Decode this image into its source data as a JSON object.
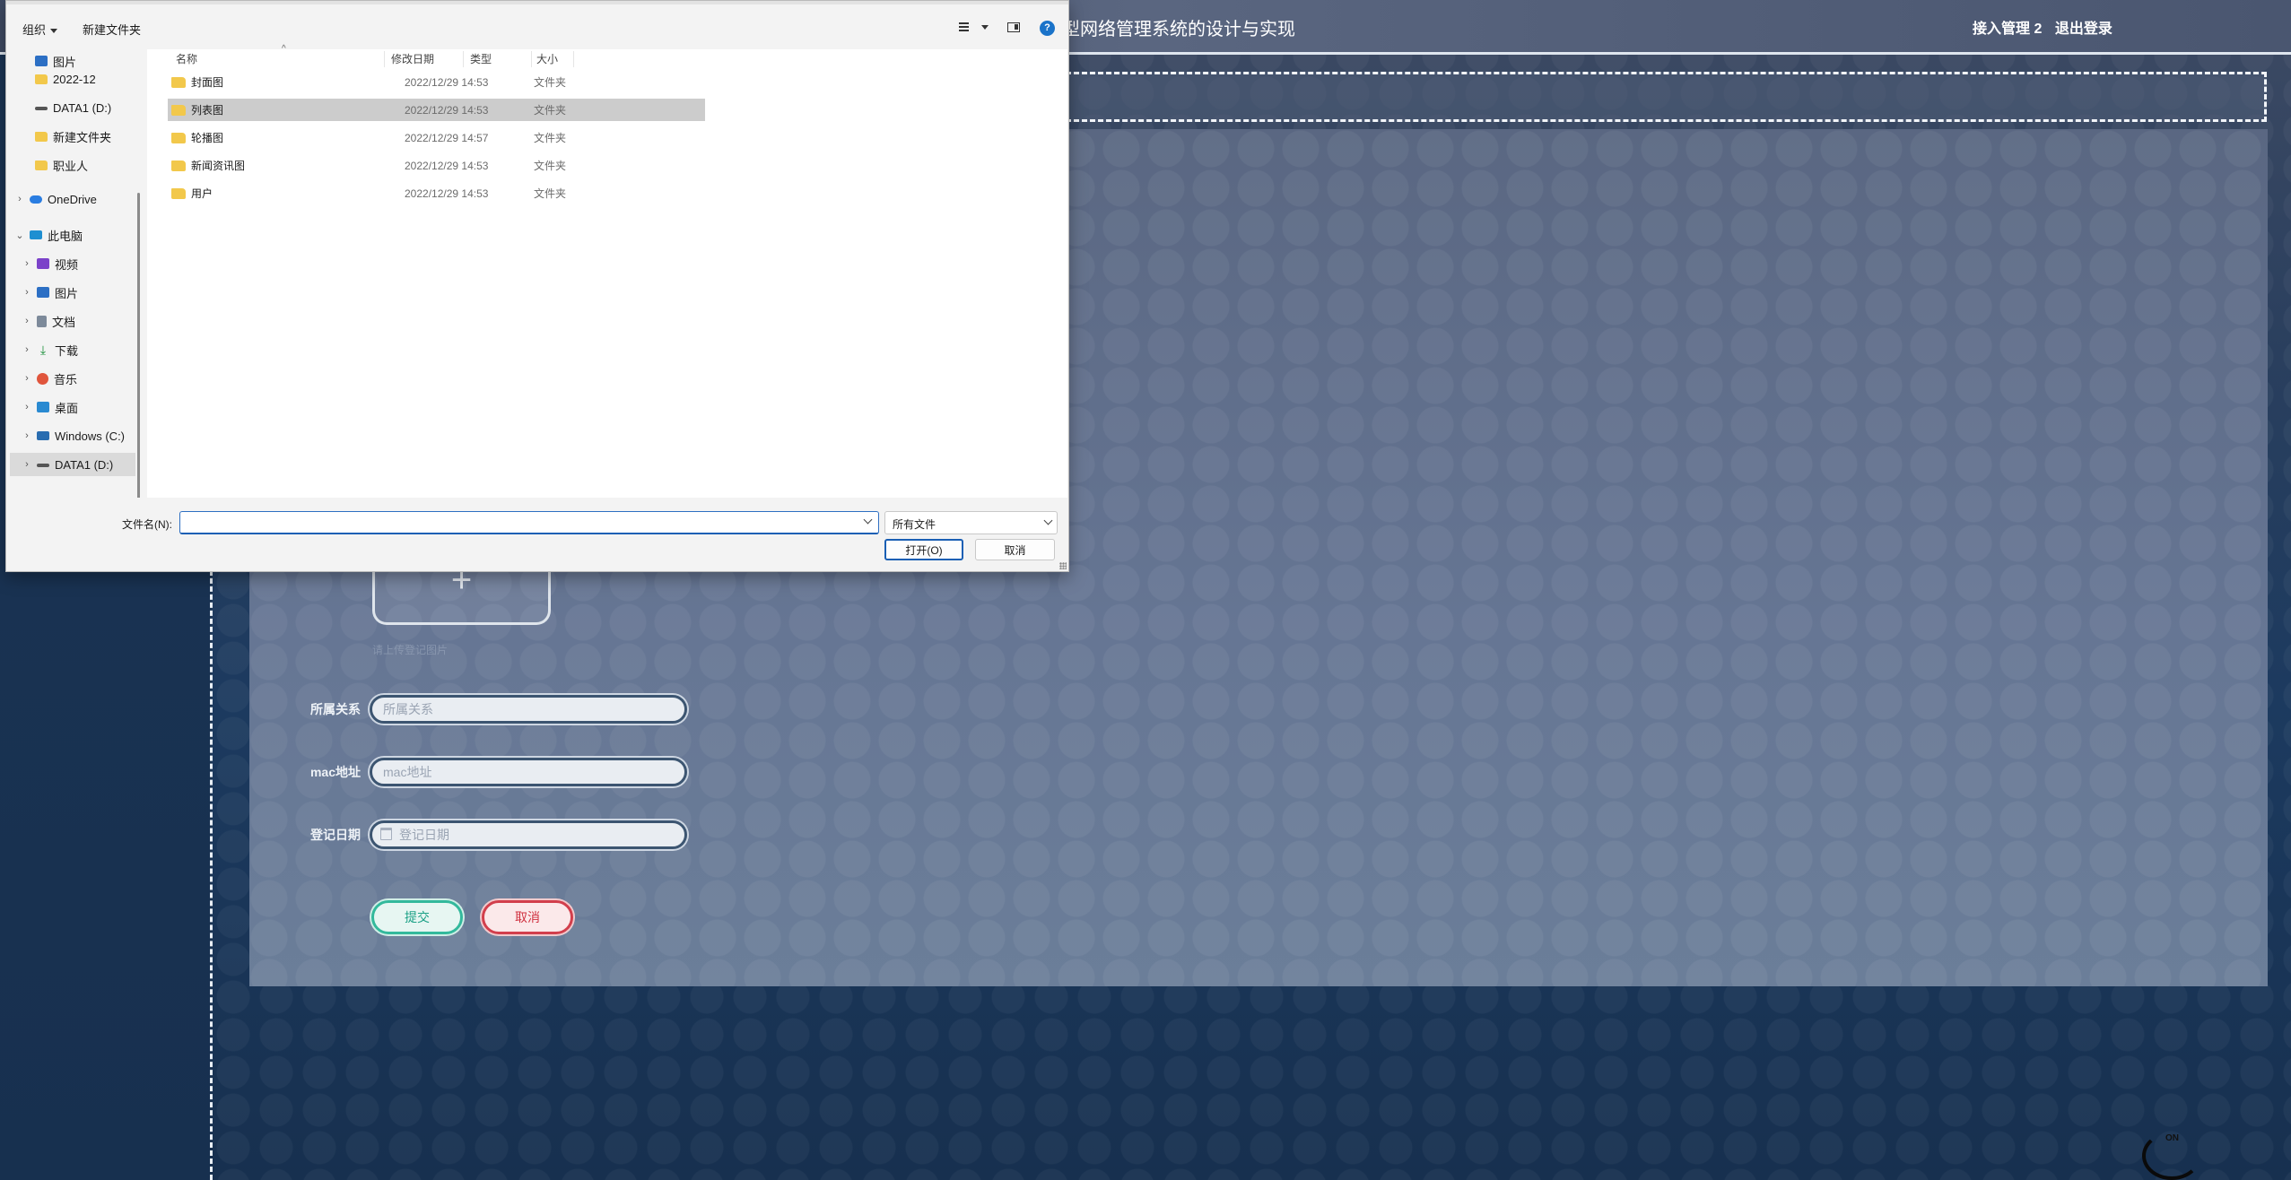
{
  "app": {
    "title": "型网络管理系统的设计与实现",
    "user_label": "接入管理 2",
    "logout_label": "退出登录"
  },
  "form": {
    "upload_hint": "请上传登记图片",
    "fields": [
      {
        "label": "所属关系",
        "placeholder": "所属关系"
      },
      {
        "label": "mac地址",
        "placeholder": "mac地址"
      },
      {
        "label": "登记日期",
        "placeholder": "登记日期"
      }
    ],
    "submit_label": "提交",
    "cancel_label": "取消"
  },
  "corner_logo_text": "ON",
  "dialog": {
    "toolbar": {
      "organize_label": "组织",
      "new_folder_label": "新建文件夹",
      "help_icon": "?"
    },
    "nav": {
      "pinned": [
        {
          "label": "图片",
          "icon": "pictures-icon"
        },
        {
          "label": "2022-12",
          "icon": "folder-icon"
        },
        {
          "label": "DATA1 (D:)",
          "icon": "drive-icon"
        },
        {
          "label": "新建文件夹",
          "icon": "folder-icon"
        },
        {
          "label": "职业人",
          "icon": "folder-icon"
        }
      ],
      "onedrive": "OneDrive",
      "this_pc": "此电脑",
      "pc_items": [
        {
          "label": "视频",
          "icon": "video-icon"
        },
        {
          "label": "图片",
          "icon": "pictures-icon"
        },
        {
          "label": "文档",
          "icon": "documents-icon"
        },
        {
          "label": "下载",
          "icon": "download-icon"
        },
        {
          "label": "音乐",
          "icon": "music-icon"
        },
        {
          "label": "桌面",
          "icon": "desktop-icon"
        },
        {
          "label": "Windows (C:)",
          "icon": "windows-drive-icon"
        },
        {
          "label": "DATA1 (D:)",
          "icon": "drive-icon"
        }
      ]
    },
    "columns": {
      "name": "名称",
      "date": "修改日期",
      "type": "类型",
      "size": "大小"
    },
    "files": [
      {
        "name": "封面图",
        "date": "2022/12/29 14:53",
        "type": "文件夹"
      },
      {
        "name": "列表图",
        "date": "2022/12/29 14:53",
        "type": "文件夹"
      },
      {
        "name": "轮播图",
        "date": "2022/12/29 14:57",
        "type": "文件夹"
      },
      {
        "name": "新闻资讯图",
        "date": "2022/12/29 14:53",
        "type": "文件夹"
      },
      {
        "name": "用户",
        "date": "2022/12/29 14:53",
        "type": "文件夹"
      }
    ],
    "filename_label": "文件名(N):",
    "filename_value": "",
    "filetype_value": "所有文件",
    "open_label": "打开(O)",
    "cancel_label": "取消"
  }
}
